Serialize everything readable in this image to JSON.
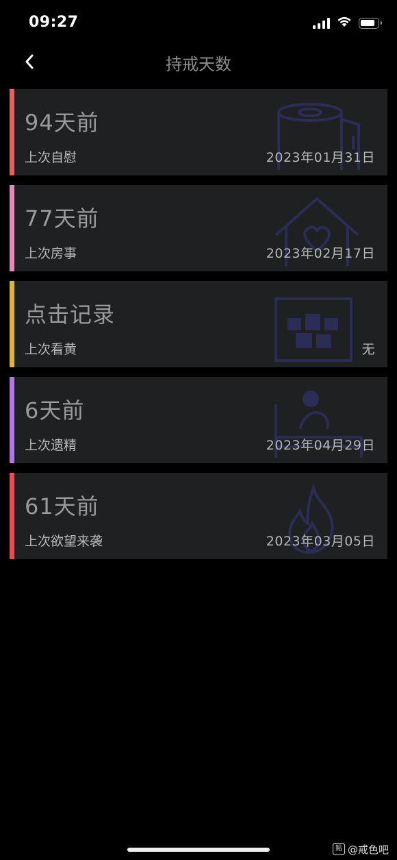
{
  "status_bar": {
    "time": "09:27",
    "icons": [
      "signal-icon",
      "wifi-icon",
      "battery-icon"
    ]
  },
  "nav": {
    "back_icon": "chevron-left-icon",
    "title": "持戒天数"
  },
  "cards": [
    {
      "value": "94天前",
      "label": "上次自慰",
      "date": "2023年01月31日",
      "accent_color": "#d9685c",
      "icon": "tissue-roll-icon"
    },
    {
      "value": "77天前",
      "label": "上次房事",
      "date": "2023年02月17日",
      "accent_color": "#d98fb8",
      "icon": "house-heart-icon"
    },
    {
      "value": "点击记录",
      "label": "上次看黄",
      "date": "无",
      "accent_color": "#d9b24a",
      "icon": "censored-18-icon"
    },
    {
      "value": "6天前",
      "label": "上次遗精",
      "date": "2023年04月29日",
      "accent_color": "#b07ad6",
      "icon": "person-in-bed-icon"
    },
    {
      "value": "61天前",
      "label": "上次欲望来袭",
      "date": "2023年03月05日",
      "accent_color": "#e0524f",
      "icon": "flame-icon"
    }
  ],
  "watermark": {
    "logo_text": "贴",
    "text": "@戒色吧"
  },
  "colors": {
    "background": "#000000",
    "card_background": "#1f2022",
    "bg_icon_stroke": "#2a2d55"
  }
}
